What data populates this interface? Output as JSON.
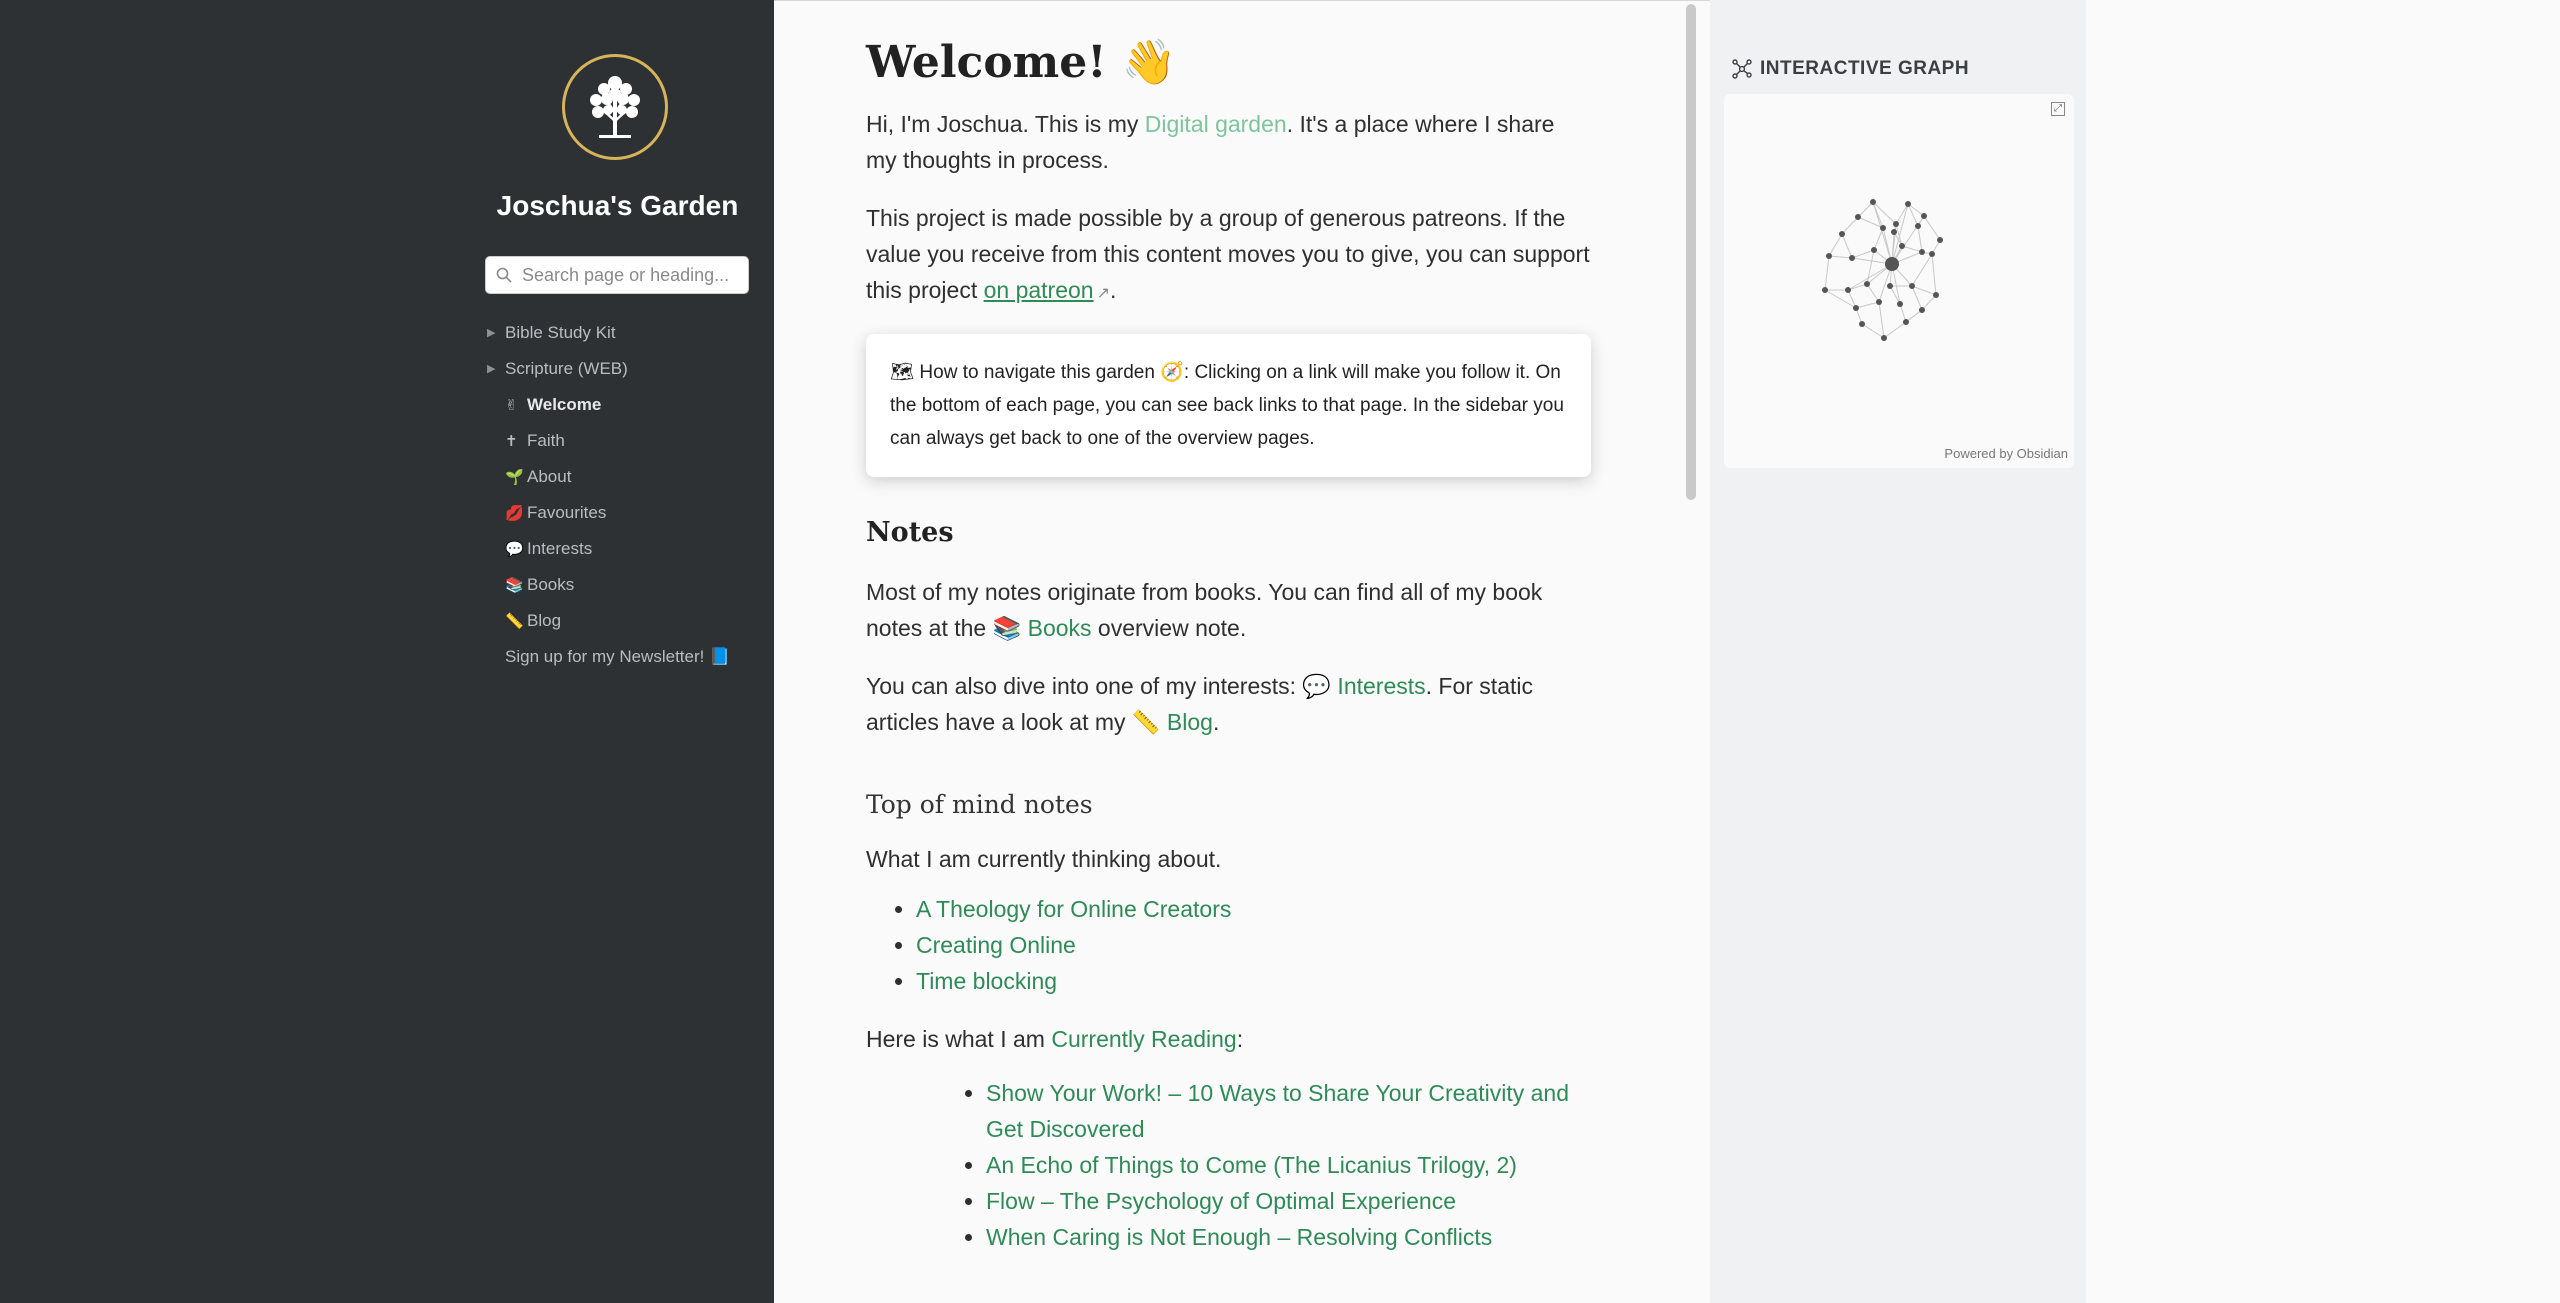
{
  "sidebar": {
    "site_title": "Joschua's Garden",
    "search_placeholder": "Search page or heading...",
    "items": [
      {
        "type": "folder",
        "label": "Bible Study Kit"
      },
      {
        "type": "folder",
        "label": "Scripture (WEB)"
      },
      {
        "type": "page",
        "emoji": "✌",
        "label": "Welcome",
        "active": true
      },
      {
        "type": "page",
        "emoji": "✝",
        "label": "Faith"
      },
      {
        "type": "page",
        "emoji": "🌱",
        "label": "About"
      },
      {
        "type": "page",
        "emoji": "💋",
        "label": "Favourites"
      },
      {
        "type": "page",
        "emoji": "💬",
        "label": "Interests"
      },
      {
        "type": "page",
        "emoji": "📚",
        "label": "Books"
      },
      {
        "type": "page",
        "emoji": "📏",
        "label": "Blog"
      },
      {
        "type": "plain",
        "label": "Sign up for my Newsletter! 📘"
      }
    ]
  },
  "main": {
    "title": "Welcome! 👋",
    "intro": {
      "before": "Hi, I'm Joschua. This is my ",
      "link": "Digital garden",
      "after": ". It's a place where I share my thoughts in process."
    },
    "patreon": {
      "before": "This project is made possible by a group of generous patreons. If the value you receive from this content moves you to give, you can support this project ",
      "link": "on patreon",
      "after": "."
    },
    "callout": {
      "before": "🗺 How to navigate this garden ",
      "emoji": "🧭",
      "after": ": Clicking on a link will make you follow it. On the bottom of each page, you can see back links to that page. In the sidebar you can always get back to one of the overview pages."
    },
    "notes_heading": "Notes",
    "notes_p1": {
      "before": "Most of my notes originate from books. You can find all of my book notes at the ",
      "link": "📚 Books",
      "after": " overview note."
    },
    "notes_p2": {
      "before": "You can also dive into one of my interests: ",
      "link1": "💬 Interests",
      "middle": ". For static articles have a look at my ",
      "link2": "📏 Blog",
      "after": "."
    },
    "top_heading": "Top of mind notes",
    "top_intro": "What I am currently thinking about.",
    "top_items": [
      "A Theology for Online Creators",
      "Creating Online",
      "Time blocking"
    ],
    "reading": {
      "before": "Here is what I am ",
      "link": "Currently Reading",
      "after": ":"
    },
    "reading_items": [
      "Show Your Work! – 10 Ways to Share Your Creativity and Get Discovered",
      "An Echo of Things to Come (The Licanius Trilogy, 2)",
      "Flow – The Psychology of Optimal Experience",
      "When Caring is Not Enough – Resolving Conflicts"
    ]
  },
  "graph": {
    "title": "INTERACTIVE GRAPH",
    "powered_by": "Powered by Obsidian",
    "node_color": "#555555",
    "edge_color": "#c8c8c8"
  },
  "colors": {
    "sidebar_bg": "#2e3134",
    "link": "#2e8b57",
    "link_pale": "#7cc59b",
    "logo_ring": "#d7b45a"
  }
}
